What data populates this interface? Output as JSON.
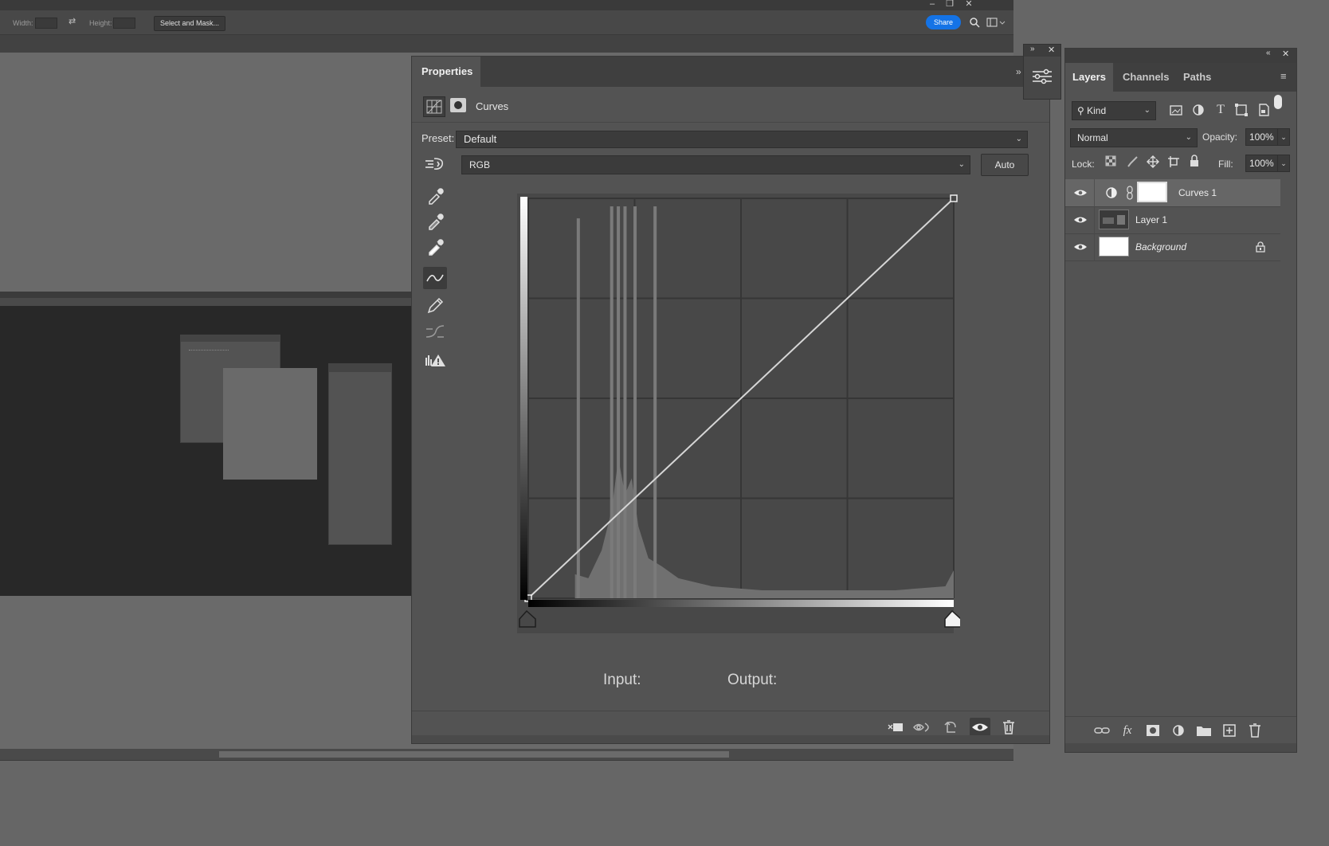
{
  "app": {
    "options_bar": {
      "width_label": "Width:",
      "height_label": "Height:",
      "select_and_mask": "Select and Mask...",
      "share": "Share"
    }
  },
  "properties": {
    "tab": "Properties",
    "adjustment_name": "Curves",
    "preset_label": "Preset:",
    "preset_value": "Default",
    "channel_value": "RGB",
    "auto_label": "Auto",
    "input_label": "Input:",
    "output_label": "Output:",
    "curve_points": [
      [
        0,
        0
      ],
      [
        255,
        255
      ]
    ],
    "histogram_spikes": [
      [
        30,
        0.95
      ],
      [
        50,
        0.98
      ],
      [
        54,
        0.98
      ],
      [
        58,
        0.98
      ],
      [
        64,
        0.98
      ],
      [
        76,
        0.98
      ]
    ],
    "histogram_bulk": [
      [
        28,
        0.06
      ],
      [
        36,
        0.05
      ],
      [
        44,
        0.12
      ],
      [
        50,
        0.22
      ],
      [
        54,
        0.35
      ],
      [
        58,
        0.26
      ],
      [
        62,
        0.3
      ],
      [
        66,
        0.18
      ],
      [
        72,
        0.1
      ],
      [
        80,
        0.08
      ],
      [
        90,
        0.05
      ],
      [
        110,
        0.03
      ],
      [
        140,
        0.02
      ],
      [
        180,
        0.02
      ],
      [
        220,
        0.02
      ],
      [
        250,
        0.03
      ],
      [
        255,
        0.07
      ]
    ]
  },
  "layers_panel": {
    "tabs": [
      "Layers",
      "Channels",
      "Paths"
    ],
    "filter_label": "Kind",
    "blend_mode": "Normal",
    "opacity_label": "Opacity:",
    "opacity_value": "100%",
    "lock_label": "Lock:",
    "fill_label": "Fill:",
    "fill_value": "100%",
    "layers": [
      {
        "name": "Curves 1",
        "selected": true
      },
      {
        "name": "Layer 1",
        "selected": false
      },
      {
        "name": "Background",
        "selected": false,
        "locked": true,
        "italic": true
      }
    ]
  },
  "colors": {
    "panel_bg": "#535353",
    "share_blue": "#1473e6",
    "selected_layer": "#6a6a6a"
  },
  "icons": {
    "properties_tools": [
      "targeted-adjustment-icon",
      "black-point-eyedropper-icon",
      "gray-point-eyedropper-icon",
      "white-point-eyedropper-icon",
      "curve-edit-points-icon",
      "pencil-draw-icon",
      "smooth-curve-icon",
      "clipping-warning-icon"
    ],
    "properties_footer": [
      "clip-to-layer-icon",
      "view-previous-state-icon",
      "reset-icon",
      "visibility-icon",
      "delete-icon"
    ],
    "layers_footer": [
      "link-layers-icon",
      "fx-icon",
      "add-mask-icon",
      "new-adjustment-icon",
      "new-group-icon",
      "new-layer-icon",
      "delete-layer-icon"
    ]
  }
}
